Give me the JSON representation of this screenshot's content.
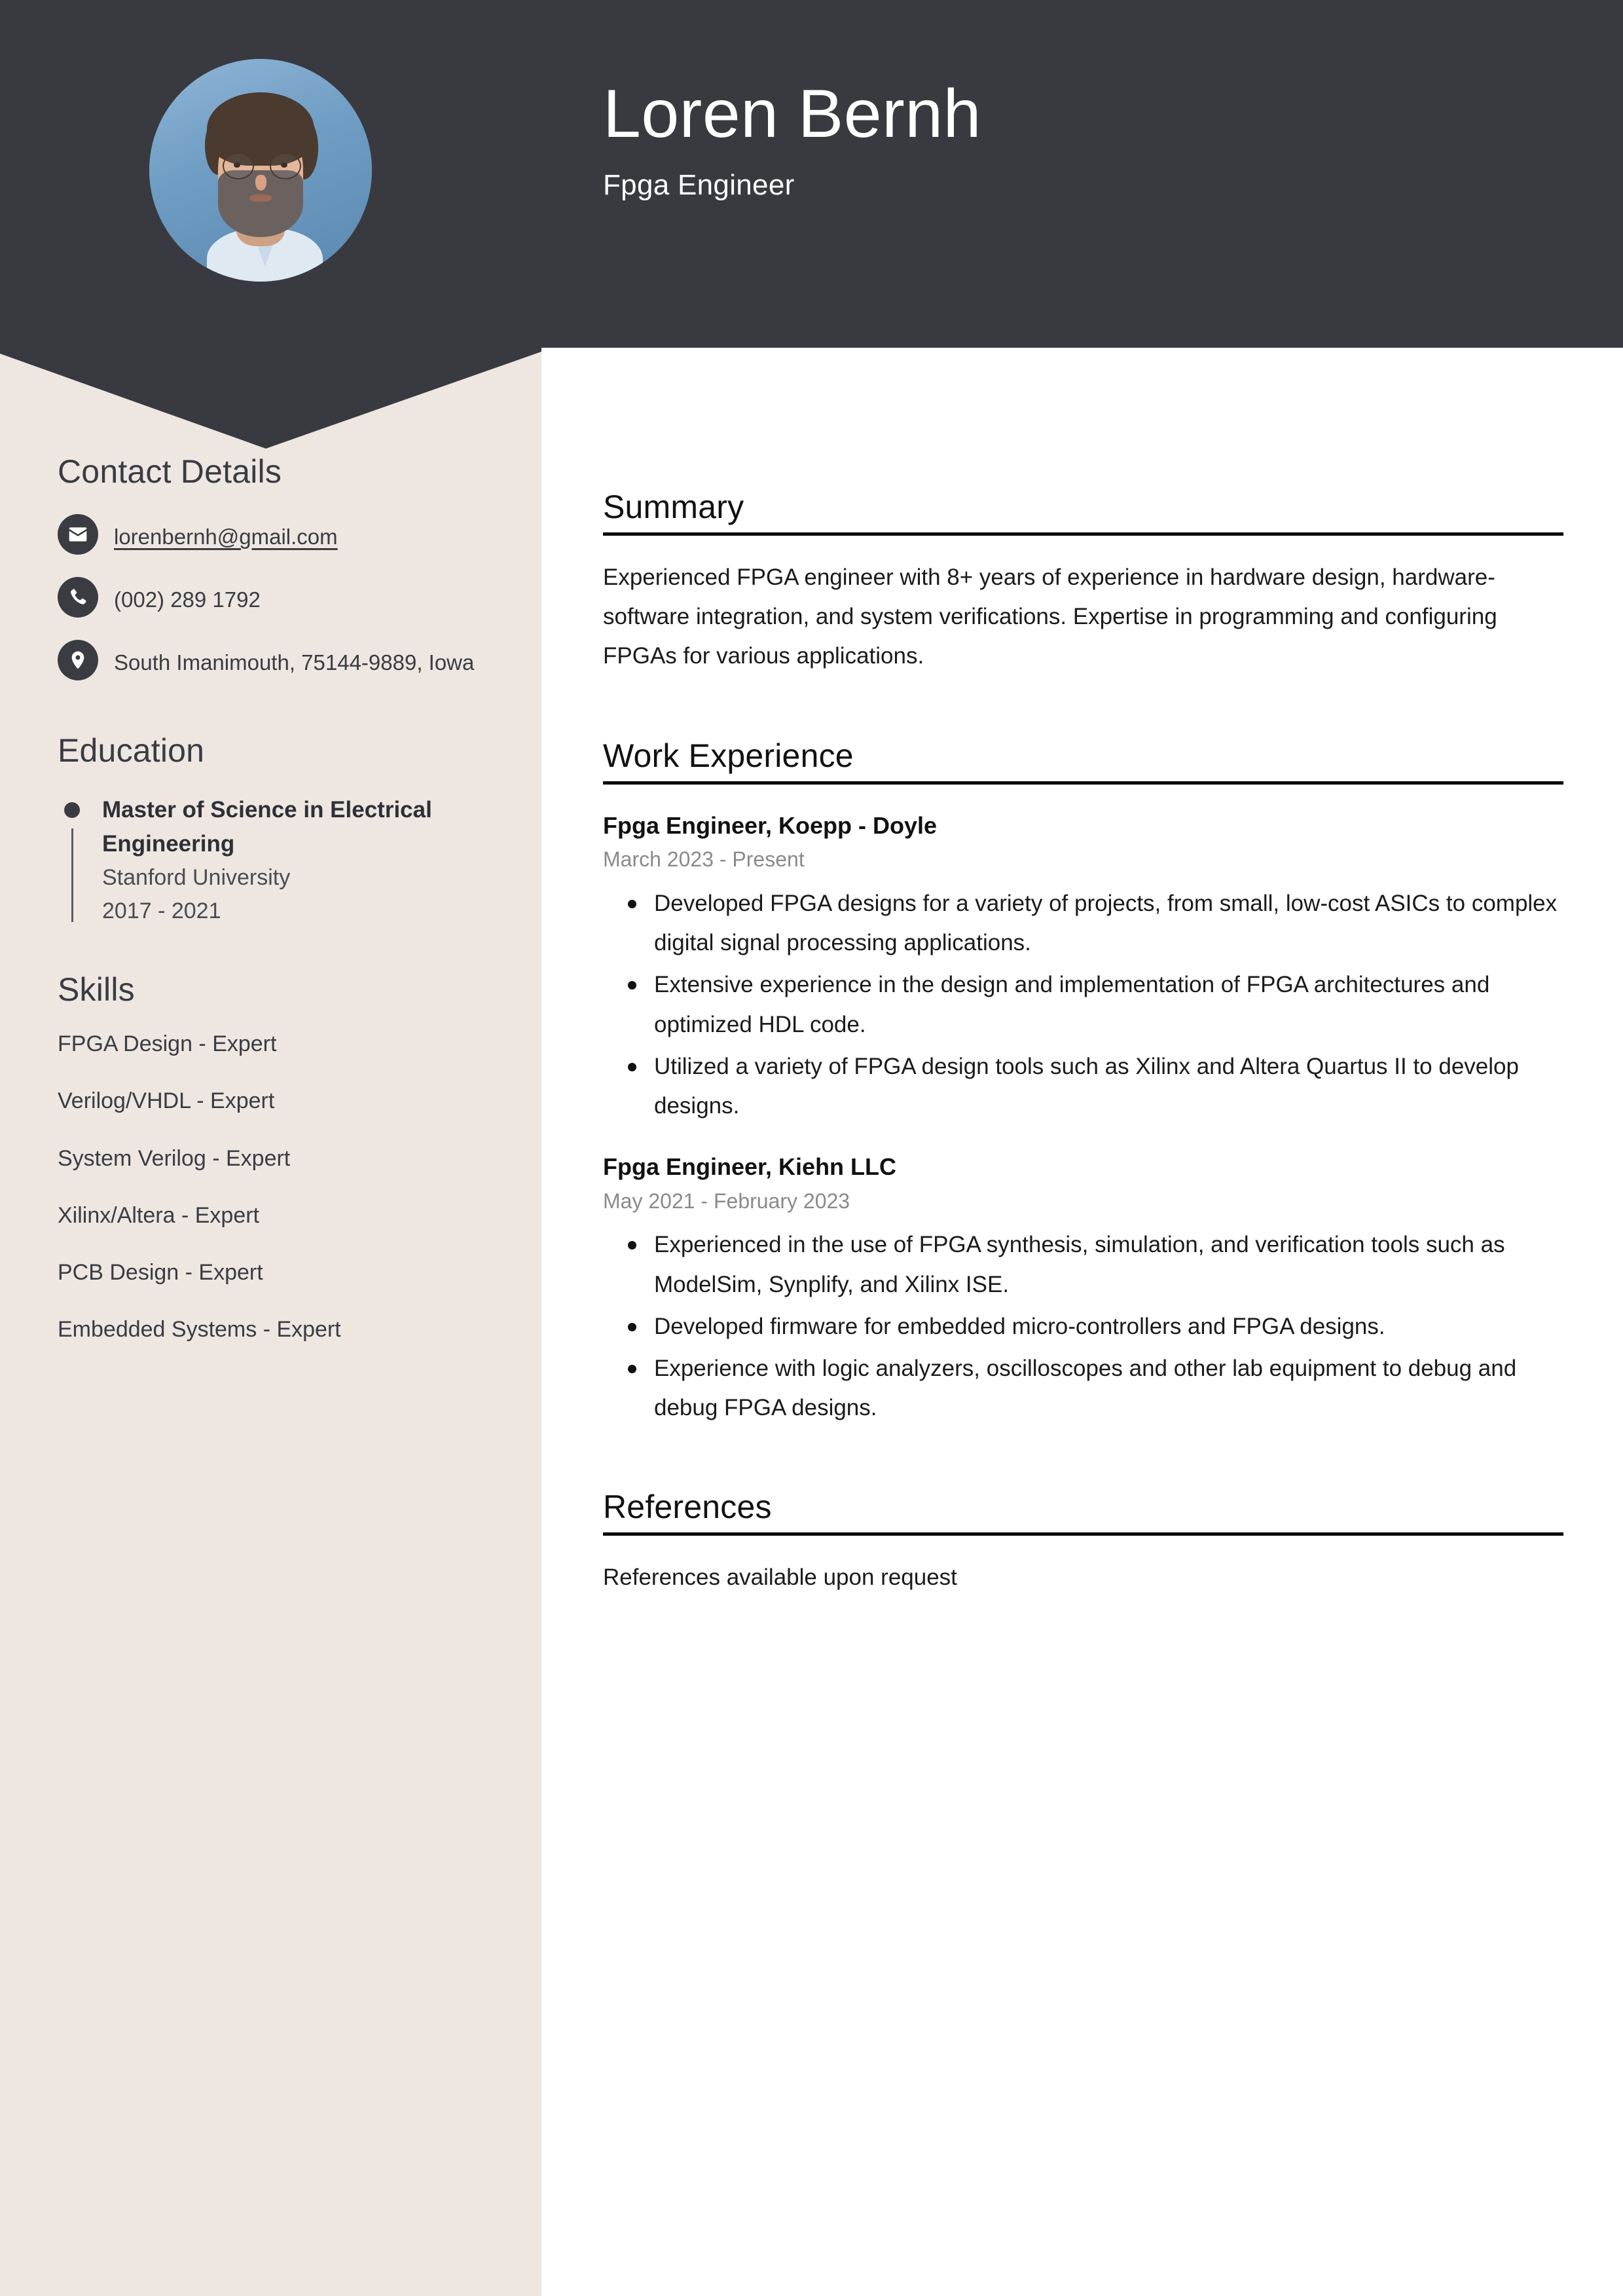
{
  "colors": {
    "header_bg": "#383A40",
    "sidebar_bg": "#EEE6E1",
    "main_bg": "#FFFFFF",
    "text_dark": "#3A3C42",
    "muted": "#8A8A8A"
  },
  "header": {
    "name": "Loren Bernh",
    "job_title": "Fpga Engineer",
    "avatar_alt": "profile-photo"
  },
  "sidebar": {
    "contact": {
      "heading": "Contact Details",
      "items": [
        {
          "icon": "envelope-icon",
          "value": "lorenbernh@gmail.com",
          "link": true
        },
        {
          "icon": "phone-icon",
          "value": "(002) 289 1792",
          "link": false
        },
        {
          "icon": "location-pin-icon",
          "value": "South Imanimouth, 75144-9889, Iowa",
          "link": false
        }
      ]
    },
    "education": {
      "heading": "Education",
      "items": [
        {
          "degree": "Master of Science in Electrical Engineering",
          "school": "Stanford University",
          "dates": "2017 - 2021"
        }
      ]
    },
    "skills": {
      "heading": "Skills",
      "items": [
        "FPGA Design - Expert",
        "Verilog/VHDL - Expert",
        "System Verilog - Expert",
        "Xilinx/Altera - Expert",
        "PCB Design - Expert",
        "Embedded Systems - Expert"
      ]
    }
  },
  "main": {
    "summary": {
      "heading": "Summary",
      "text": "Experienced FPGA engineer with 8+ years of experience in hardware design, hardware-software integration, and system verifications. Expertise in programming and configuring FPGAs for various applications."
    },
    "work_experience": {
      "heading": "Work Experience",
      "jobs": [
        {
          "title": "Fpga Engineer, Koepp - Doyle",
          "dates": "March 2023 - Present",
          "bullets": [
            "Developed FPGA designs for a variety of projects, from small, low-cost ASICs to complex digital signal processing applications.",
            "Extensive experience in the design and implementation of FPGA architectures and optimized HDL code.",
            "Utilized a variety of FPGA design tools such as Xilinx and Altera Quartus II to develop designs."
          ]
        },
        {
          "title": "Fpga Engineer, Kiehn LLC",
          "dates": "May 2021 - February 2023",
          "bullets": [
            "Experienced in the use of FPGA synthesis, simulation, and verification tools such as ModelSim, Synplify, and Xilinx ISE.",
            "Developed firmware for embedded micro-controllers and FPGA designs.",
            "Experience with logic analyzers, oscilloscopes and other lab equipment to debug and debug FPGA designs."
          ]
        }
      ]
    },
    "references": {
      "heading": "References",
      "text": "References available upon request"
    }
  }
}
